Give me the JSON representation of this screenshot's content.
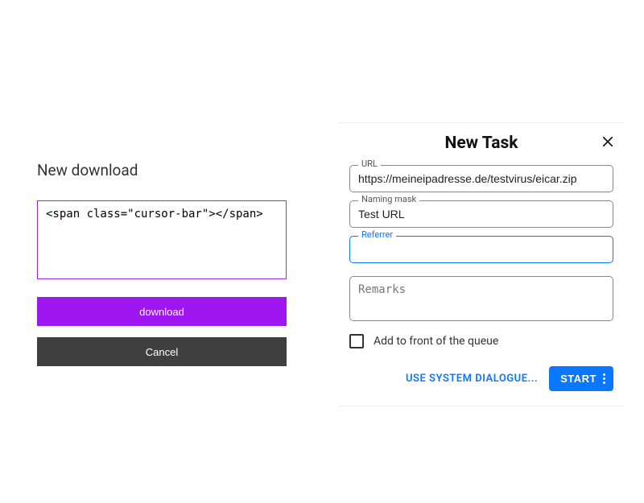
{
  "left": {
    "title": "New download",
    "textarea_value": "",
    "download_label": "download",
    "cancel_label": "Cancel"
  },
  "right": {
    "title": "New Task",
    "url_label": "URL",
    "url_value": "https://meineipadresse.de/testvirus/eicar.zip",
    "naming_label": "Naming mask",
    "naming_value": "Test URL",
    "referrer_label": "Referrer",
    "referrer_value": "",
    "remarks_placeholder": "Remarks",
    "remarks_value": "",
    "queue_label": "Add to front of the queue",
    "queue_checked": false,
    "system_dialogue_label": "USE SYSTEM DIALOGUE...",
    "start_label": "START"
  }
}
